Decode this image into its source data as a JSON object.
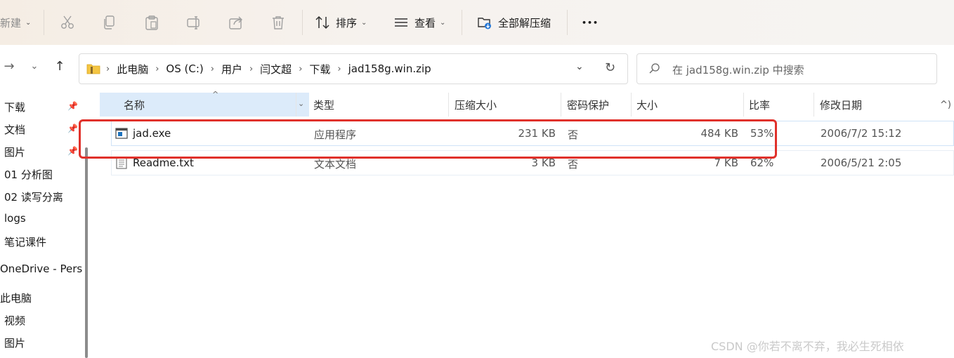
{
  "toolbar": {
    "new_label": "新建",
    "sort_label": "排序",
    "view_label": "查看",
    "extract_label": "全部解压缩",
    "more_label": "•••"
  },
  "address": {
    "crumbs": [
      "此电脑",
      "OS (C:)",
      "用户",
      "闫文超",
      "下载",
      "jad158g.win.zip"
    ],
    "search_placeholder": "在 jad158g.win.zip 中搜索"
  },
  "sidebar": {
    "items": [
      "下载",
      "文档",
      "图片",
      "01 分析图",
      "02 读写分离",
      "logs",
      "笔记课件",
      "OneDrive - Perso",
      "此电脑",
      "视频",
      "图片"
    ]
  },
  "columns": {
    "name": "名称",
    "type": "类型",
    "compressed": "压缩大小",
    "password": "密码保护",
    "size": "大小",
    "ratio": "比率",
    "modified": "修改日期",
    "overflow": "^)"
  },
  "files": [
    {
      "name": "jad.exe",
      "type": "应用程序",
      "compressed": "231 KB",
      "password": "否",
      "size": "484 KB",
      "ratio": "53%",
      "modified": "2006/7/2 15:12"
    },
    {
      "name": "Readme.txt",
      "type": "文本文档",
      "compressed": "3 KB",
      "password": "否",
      "size": "7 KB",
      "ratio": "62%",
      "modified": "2006/5/21 2:05"
    }
  ],
  "watermark": "CSDN @你若不离不弃，我必生死相依"
}
